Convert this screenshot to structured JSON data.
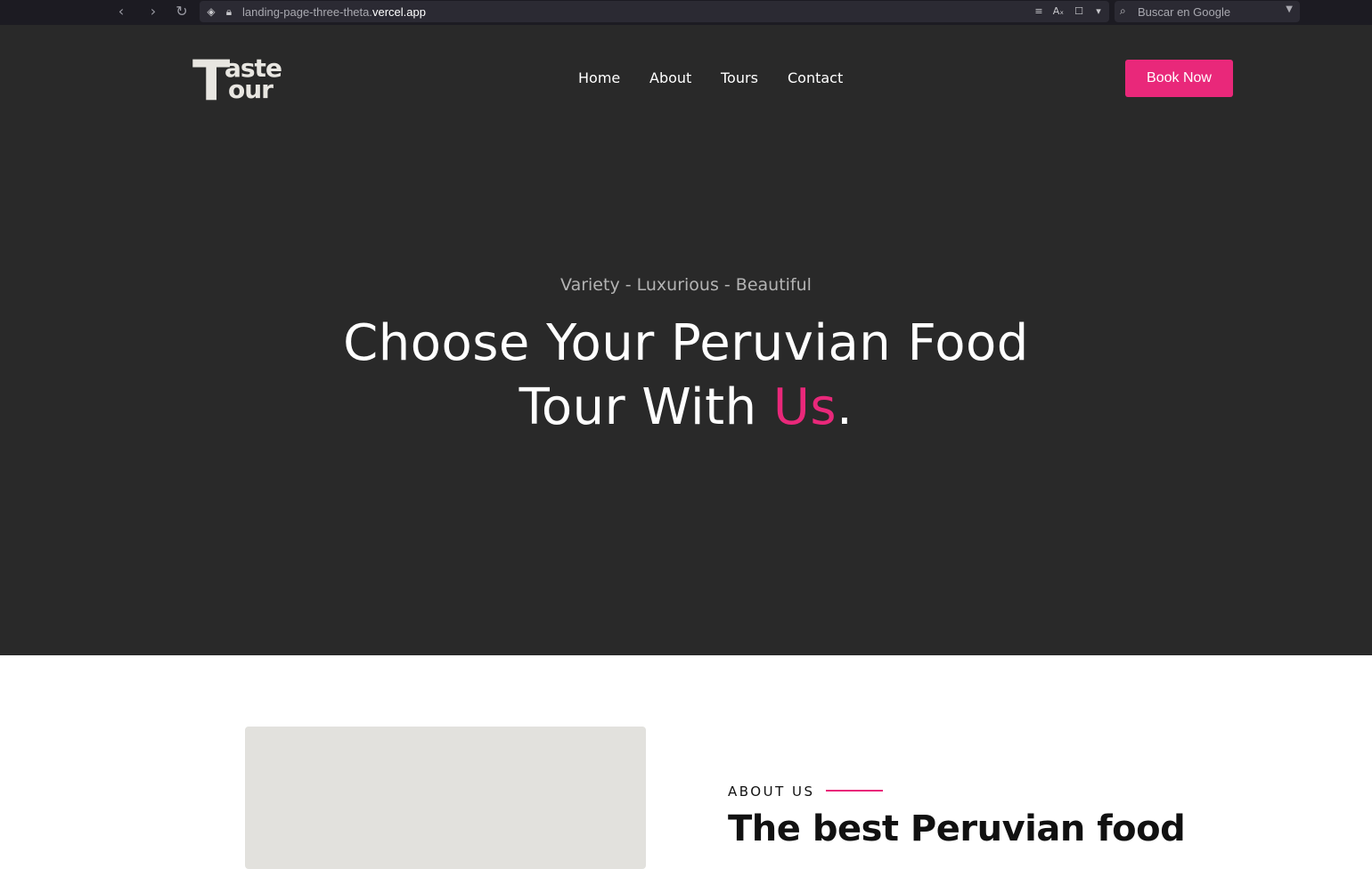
{
  "browser": {
    "url_prefix": "landing-page-three-theta.",
    "url_domain": "vercel.app",
    "search_placeholder": "Buscar en Google"
  },
  "header": {
    "logo_text_top": "aste",
    "logo_text_bottom": "our",
    "logo_letter": "T",
    "nav": [
      {
        "label": "Home"
      },
      {
        "label": "About"
      },
      {
        "label": "Tours"
      },
      {
        "label": "Contact"
      }
    ],
    "cta_label": "Book Now"
  },
  "hero": {
    "tagline": "Variety - Luxurious - Beautiful",
    "headline_line1": "Choose Your Peruvian Food",
    "headline_line2_pre": "Tour With ",
    "headline_accent": "Us",
    "headline_end": "."
  },
  "about": {
    "label": "ABOUT US",
    "title": "The best Peruvian food"
  },
  "colors": {
    "accent": "#e9287a",
    "hero_bg": "#292929",
    "image_placeholder": "#e2e1dd"
  }
}
